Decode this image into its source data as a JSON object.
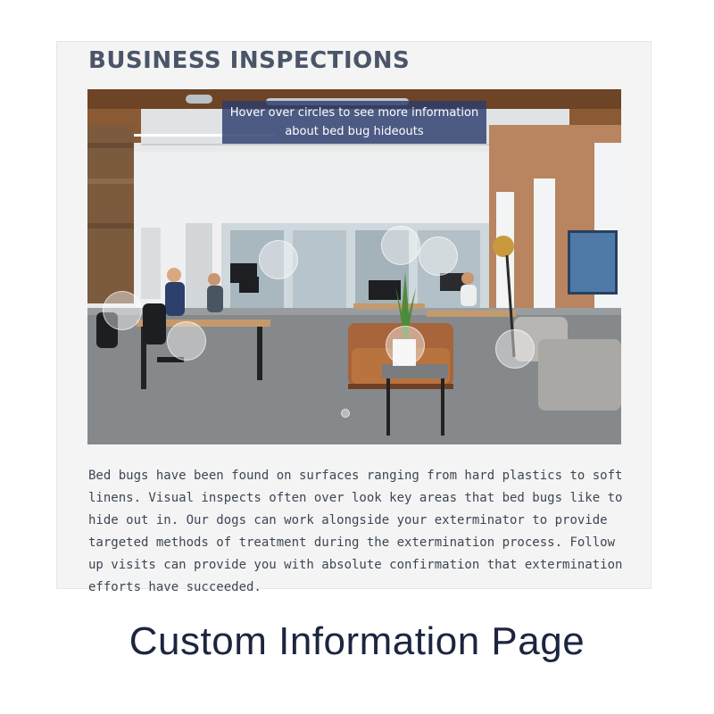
{
  "section": {
    "title": "BUSINESS INSPECTIONS",
    "tooltip_line1": "Hover over circles to see more information",
    "tooltip_line2": "about bed bug hideouts",
    "description": "Bed bugs have been found on surfaces ranging from hard plastics to soft linens. Visual inspects often over look key areas that bed bugs like to hide out in. Our dogs can work alongside your exterminator to provide targeted methods of treatment during the extermination process. Follow up visits can provide you with absolute confirmation that extermination efforts have succeeded."
  },
  "hotspots": [
    {
      "name": "hotspot-1"
    },
    {
      "name": "hotspot-2"
    },
    {
      "name": "hotspot-3"
    },
    {
      "name": "hotspot-4"
    },
    {
      "name": "hotspot-5"
    },
    {
      "name": "hotspot-6"
    },
    {
      "name": "hotspot-7"
    },
    {
      "name": "hotspot-8"
    }
  ],
  "caption": "Custom Information Page",
  "colors": {
    "title": "#4a5568",
    "tooltip_bg": "#2c3c6e",
    "caption": "#1c2540",
    "card_bg": "#f4f4f4"
  }
}
